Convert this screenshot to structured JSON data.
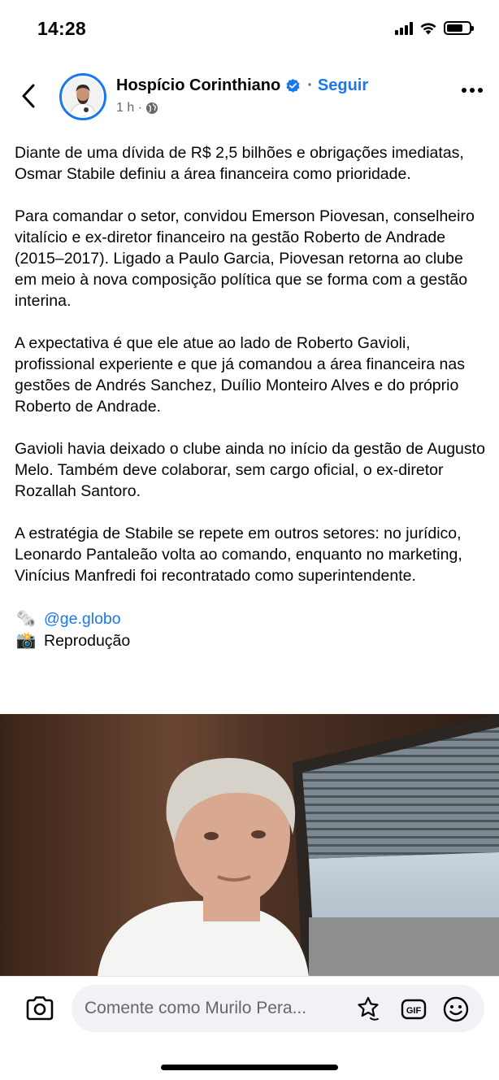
{
  "status_bar": {
    "time": "14:28",
    "icons": [
      "signal-icon",
      "wifi-icon",
      "battery-icon"
    ],
    "battery_level": 0.72
  },
  "header": {
    "back_icon": "chevron-left-icon",
    "page_name": "Hospício Corinthiano",
    "verified_icon": "verified-badge-icon",
    "separator": "·",
    "follow_label": "Seguir",
    "time_ago": "1 h ·",
    "audience_icon": "globe-icon",
    "more_icon": "more-horizontal-icon"
  },
  "post": {
    "paragraphs": [
      "Diante de uma dívida de R$ 2,5 bilhões e obrigações imediatas, Osmar Stabile definiu a área financeira como prioridade.",
      "Para comandar o setor, convidou Emerson Piovesan, conselheiro vitalício e ex-diretor financeiro na gestão Roberto de Andrade (2015–2017). Ligado a Paulo Garcia, Piovesan retorna ao clube em meio à nova composição política que se forma com a gestão interina.",
      "A expectativa é que ele atue ao lado de Roberto Gavioli, profissional experiente e que já comandou a área financeira nas gestões de Andrés Sanchez, Duílio Monteiro Alves e do próprio Roberto de Andrade.",
      "Gavioli havia deixado o clube ainda no início da gestão de Augusto Melo. Também deve colaborar, sem cargo oficial, o ex-diretor Rozallah Santoro.",
      "A estratégia de Stabile se repete em outros setores: no jurídico, Leonardo Pantaleão volta ao comando, enquanto no marketing, Vinícius Manfredi foi recontratado como superintendente."
    ],
    "source_emoji": "🗞️",
    "source_handle": "@ge.globo",
    "photo_emoji": "📸",
    "photo_credit": "Reprodução"
  },
  "comment_bar": {
    "camera_icon": "camera-icon",
    "placeholder": "Comente como Murilo Pera...",
    "sticker_icon": "sticker-icon",
    "gif_label": "GIF",
    "emoji_icon": "smiley-icon"
  },
  "colors": {
    "accent": "#1877f2",
    "text": "#050505",
    "secondary": "#65676b",
    "input_bg": "#f0f2f5"
  }
}
